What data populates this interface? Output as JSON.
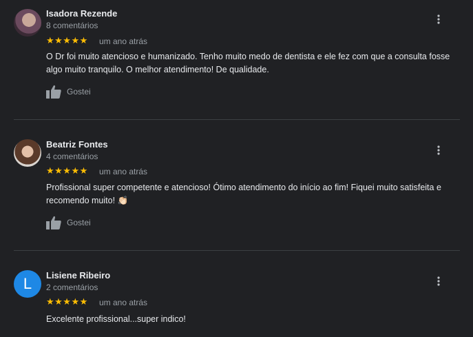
{
  "reviews": [
    {
      "name": "Isadora Rezende",
      "count": "8 comentários",
      "stars": "★★★★★",
      "rating": 5,
      "time": "um ano atrás",
      "text": "O Dr foi muito atencioso e humanizado. Tenho muito medo de dentista e ele fez com que a consulta fosse algo muito tranquilo. O melhor atendimento! De qualidade.",
      "like_label": "Gostei",
      "avatar_icon": "profile-photo"
    },
    {
      "name": "Beatriz Fontes",
      "count": "4 comentários",
      "stars": "★★★★★",
      "rating": 5,
      "time": "um ano atrás",
      "text": "Profissional super competente e atencioso! Ótimo atendimento do início ao fim! Fiquei muito satisfeita e recomendo muito! 👏🏻",
      "like_label": "Gostei",
      "avatar_icon": "profile-photo"
    },
    {
      "name": "Lisiene Ribeiro",
      "count": "2 comentários",
      "stars": "★★★★★",
      "rating": 5,
      "time": "um ano atrás",
      "text": "Excelente profissional...super indico!",
      "avatar_letter": "L",
      "avatar_color": "#1e88e5"
    }
  ],
  "colors": {
    "background": "#202124",
    "star": "#fbbc04",
    "secondary_text": "#9aa0a6",
    "divider": "#3c4043"
  },
  "icons": {
    "like": "thumbs-up-icon",
    "menu": "more-vertical-icon"
  }
}
